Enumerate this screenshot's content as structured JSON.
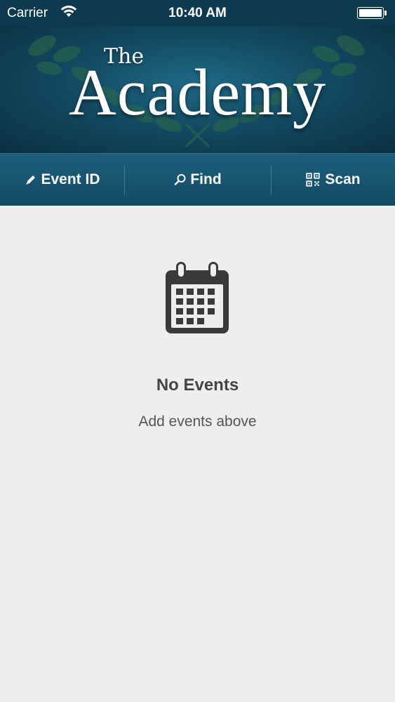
{
  "status_bar": {
    "carrier": "Carrier",
    "time": "10:40 AM",
    "battery_level": 1.0
  },
  "header": {
    "logo_small": "The",
    "logo_large": "Academy"
  },
  "toolbar": {
    "items": [
      {
        "label": "Event ID",
        "icon": "pencil-icon"
      },
      {
        "label": "Find",
        "icon": "search-icon"
      },
      {
        "label": "Scan",
        "icon": "qr-code-icon"
      }
    ]
  },
  "empty_state": {
    "icon": "calendar-icon",
    "title": "No Events",
    "subtitle": "Add events above"
  },
  "colors": {
    "status_bar": "#0d3a4f",
    "banner": "#134b63",
    "toolbar": "#1a5672",
    "background": "#eeeeee",
    "icon": "#3a3a3a"
  }
}
